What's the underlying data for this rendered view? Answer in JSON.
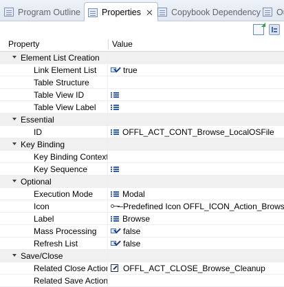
{
  "tabs": [
    {
      "label": "Program Outline",
      "icon": "outline-icon",
      "active": false
    },
    {
      "label": "Properties",
      "icon": "properties-icon",
      "active": true
    },
    {
      "label": "Copybook Dependency",
      "icon": "dependency-icon",
      "active": false
    },
    {
      "label": "Ou",
      "icon": "outline-icon",
      "active": false
    }
  ],
  "toolbar": {
    "buttons": [
      "new-property-icon",
      "categories-toggle-icon"
    ]
  },
  "table": {
    "header_property": "Property",
    "header_value": "Value"
  },
  "rows": [
    {
      "type": "category",
      "label": "Element List Creation"
    },
    {
      "type": "prop",
      "label": "Link Element List",
      "icon": "check-icon",
      "value": "true"
    },
    {
      "type": "prop",
      "label": "Table Structure",
      "icon": "",
      "value": ""
    },
    {
      "type": "prop",
      "label": "Table View ID",
      "icon": "list-icon",
      "value": ""
    },
    {
      "type": "prop",
      "label": "Table View Label",
      "icon": "list-icon",
      "value": ""
    },
    {
      "type": "category",
      "label": "Essential"
    },
    {
      "type": "prop",
      "label": "ID",
      "icon": "list-icon",
      "value": "OFFL_ACT_CONT_Browse_LocalOSFile"
    },
    {
      "type": "category",
      "label": "Key Binding"
    },
    {
      "type": "prop",
      "label": "Key Binding Context",
      "icon": "",
      "value": ""
    },
    {
      "type": "prop",
      "label": "Key Sequence",
      "icon": "list-icon",
      "value": ""
    },
    {
      "type": "category",
      "label": "Optional"
    },
    {
      "type": "prop",
      "label": "Execution Mode",
      "icon": "list-icon",
      "value": "Modal"
    },
    {
      "type": "prop",
      "label": "Icon",
      "icon": "key-icon",
      "value": "Predefined Icon OFFL_ICON_Action_Browse"
    },
    {
      "type": "prop",
      "label": "Label",
      "icon": "list-icon",
      "value": "Browse"
    },
    {
      "type": "prop",
      "label": "Mass Processing",
      "icon": "check-icon",
      "value": "false"
    },
    {
      "type": "prop",
      "label": "Refresh List",
      "icon": "check-icon",
      "value": "false"
    },
    {
      "type": "category",
      "label": "Save/Close"
    },
    {
      "type": "prop",
      "label": "Related Close Action",
      "icon": "edit-icon",
      "value": "OFFL_ACT_CLOSE_Browse_Cleanup"
    },
    {
      "type": "prop",
      "label": "Related Save Action",
      "icon": "",
      "value": ""
    }
  ]
}
